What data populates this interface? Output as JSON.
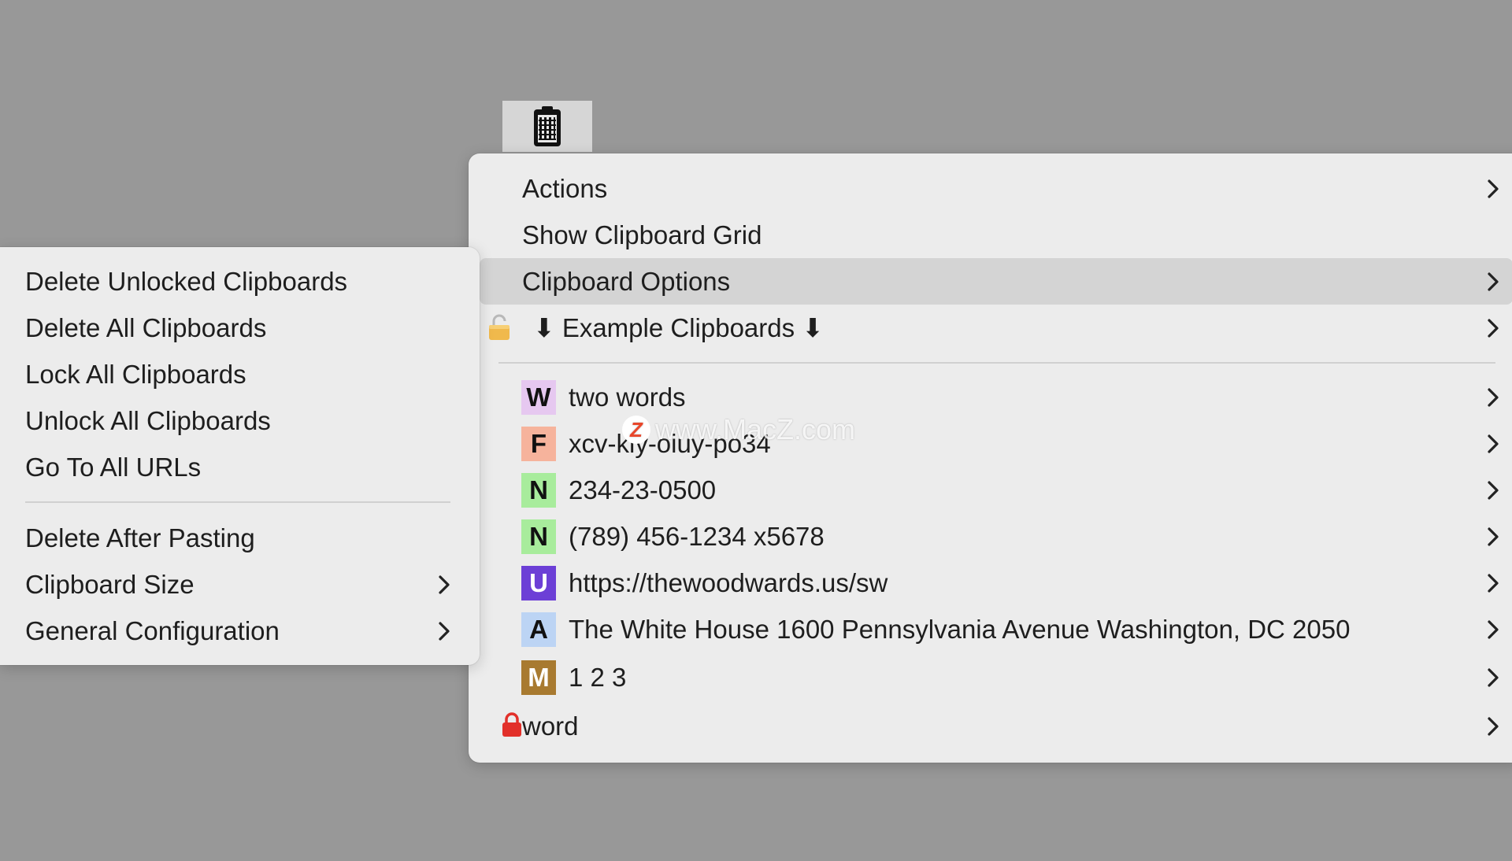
{
  "menubar": {
    "icon": "clipboard-icon"
  },
  "main_menu": {
    "items": [
      {
        "label": "Actions",
        "has_submenu": true
      },
      {
        "label": "Show Clipboard Grid",
        "has_submenu": false
      },
      {
        "label": "Clipboard Options",
        "has_submenu": true,
        "highlighted": true
      },
      {
        "label": "⬇ Example Clipboards ⬇",
        "has_submenu": true,
        "icon": "unlocked-padlock-icon"
      }
    ],
    "clipboards": [
      {
        "badge": "W",
        "badge_color": "#e6c8f0",
        "label": "two words"
      },
      {
        "badge": "F",
        "badge_color": "#f6b39c",
        "label": "xcv-kly-oiuy-po34"
      },
      {
        "badge": "N",
        "badge_color": "#a8ec9c",
        "label": "234-23-0500"
      },
      {
        "badge": "N",
        "badge_color": "#a8ec9c",
        "label": "(789) 456-1234 x5678"
      },
      {
        "badge": "U",
        "badge_color": "#6c3fd6",
        "label": "https://thewoodwards.us/sw"
      },
      {
        "badge": "A",
        "badge_color": "#bcd4f4",
        "label": "The White House 1600 Pennsylvania Avenue Washington, DC 2050"
      },
      {
        "badge": "M",
        "badge_color": "#a87a30",
        "label": "1 2 3"
      }
    ],
    "locked_item": {
      "label": "word",
      "icon": "locked-padlock-icon",
      "lock_color": "#e2302a"
    }
  },
  "sub_menu": {
    "items": [
      {
        "label": "Delete Unlocked Clipboards"
      },
      {
        "label": "Delete All Clipboards"
      },
      {
        "label": "Lock All Clipboards"
      },
      {
        "label": "Unlock All Clipboards"
      },
      {
        "label": "Go To All URLs"
      }
    ],
    "items2": [
      {
        "label": "Delete After Pasting",
        "has_submenu": false
      },
      {
        "label": "Clipboard Size",
        "has_submenu": true
      },
      {
        "label": "General Configuration",
        "has_submenu": true
      }
    ]
  },
  "watermark": {
    "logo": "Z",
    "text": "www.MacZ.com"
  }
}
